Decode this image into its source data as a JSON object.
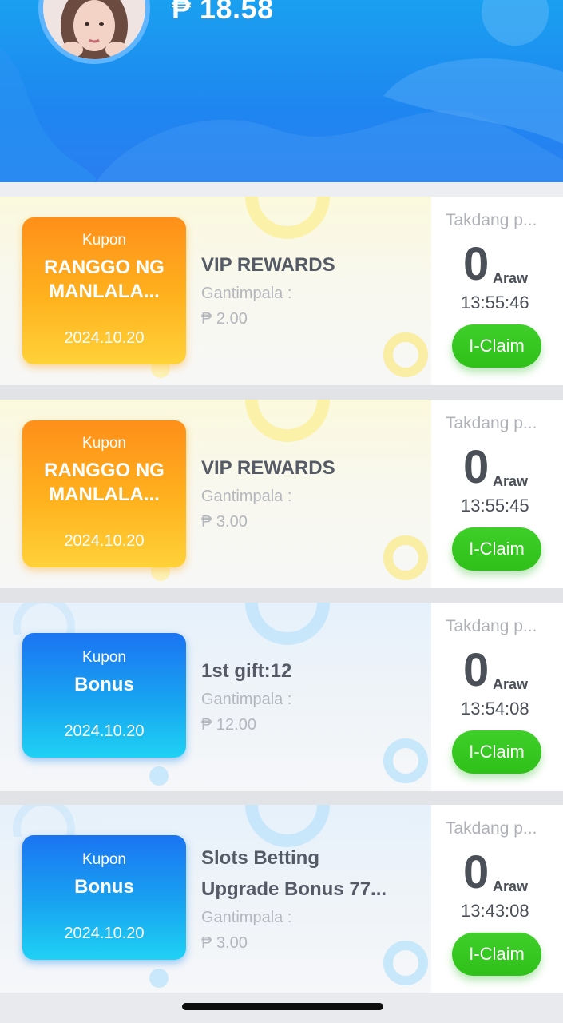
{
  "header": {
    "balance": "₱ 18.58"
  },
  "coupons": [
    {
      "theme": "orange",
      "kupon": "Kupon",
      "name_line1": "RANGGO NG",
      "name_line2": "MANLALA...",
      "date": "2024.10.20",
      "title_line1": "VIP REWARDS",
      "title_line2": "",
      "reward_label": "Gantimpala :",
      "reward_amount": "₱ 2.00",
      "deadline_label": "Takdang p...",
      "days": "0",
      "days_unit": "Araw",
      "time": "13:55:46",
      "claim_label": "I-Claim"
    },
    {
      "theme": "orange",
      "kupon": "Kupon",
      "name_line1": "RANGGO NG",
      "name_line2": "MANLALA...",
      "date": "2024.10.20",
      "title_line1": "VIP REWARDS",
      "title_line2": "",
      "reward_label": "Gantimpala :",
      "reward_amount": "₱ 3.00",
      "deadline_label": "Takdang p...",
      "days": "0",
      "days_unit": "Araw",
      "time": "13:55:45",
      "claim_label": "I-Claim"
    },
    {
      "theme": "blue",
      "kupon": "Kupon",
      "name_line1": "Bonus",
      "name_line2": "",
      "date": "2024.10.20",
      "title_line1": "1st gift:12",
      "title_line2": "",
      "reward_label": "Gantimpala :",
      "reward_amount": "₱ 12.00",
      "deadline_label": "Takdang p...",
      "days": "0",
      "days_unit": "Araw",
      "time": "13:54:08",
      "claim_label": "I-Claim"
    },
    {
      "theme": "blue",
      "kupon": "Kupon",
      "name_line1": "Bonus",
      "name_line2": "",
      "date": "2024.10.20",
      "title_line1": "Slots Betting",
      "title_line2": "Upgrade Bonus 77...",
      "reward_label": "Gantimpala :",
      "reward_amount": "₱ 3.00",
      "deadline_label": "Takdang p...",
      "days": "0",
      "days_unit": "Araw",
      "time": "13:43:08",
      "claim_label": "I-Claim"
    }
  ],
  "colors": {
    "header_blue": "#1e86f0",
    "ticket_orange": "#ffb21e",
    "ticket_blue": "#18a4f1",
    "claim_green": "#2fc01a"
  }
}
